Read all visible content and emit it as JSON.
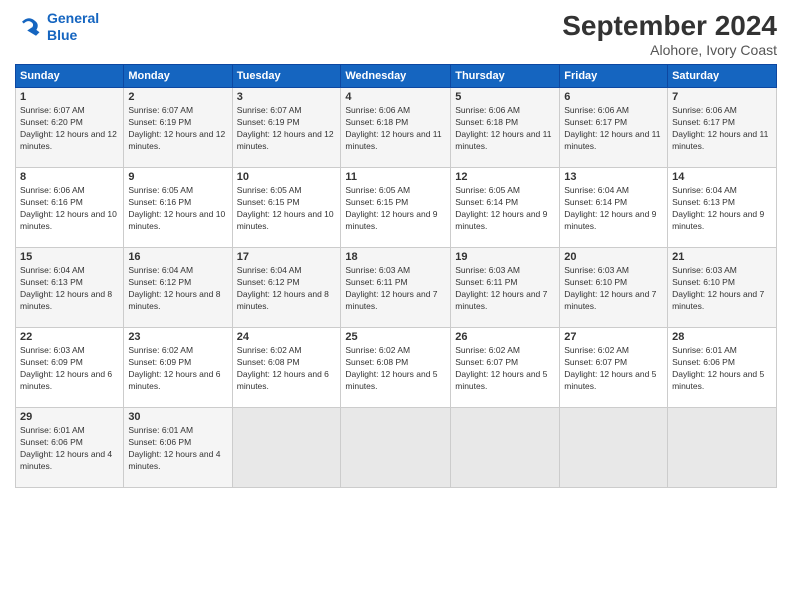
{
  "header": {
    "logo_line1": "General",
    "logo_line2": "Blue",
    "month": "September 2024",
    "location": "Alohore, Ivory Coast"
  },
  "weekdays": [
    "Sunday",
    "Monday",
    "Tuesday",
    "Wednesday",
    "Thursday",
    "Friday",
    "Saturday"
  ],
  "weeks": [
    [
      {
        "day": "1",
        "sunrise": "6:07 AM",
        "sunset": "6:20 PM",
        "daylight": "12 hours and 12 minutes."
      },
      {
        "day": "2",
        "sunrise": "6:07 AM",
        "sunset": "6:19 PM",
        "daylight": "12 hours and 12 minutes."
      },
      {
        "day": "3",
        "sunrise": "6:07 AM",
        "sunset": "6:19 PM",
        "daylight": "12 hours and 12 minutes."
      },
      {
        "day": "4",
        "sunrise": "6:06 AM",
        "sunset": "6:18 PM",
        "daylight": "12 hours and 11 minutes."
      },
      {
        "day": "5",
        "sunrise": "6:06 AM",
        "sunset": "6:18 PM",
        "daylight": "12 hours and 11 minutes."
      },
      {
        "day": "6",
        "sunrise": "6:06 AM",
        "sunset": "6:17 PM",
        "daylight": "12 hours and 11 minutes."
      },
      {
        "day": "7",
        "sunrise": "6:06 AM",
        "sunset": "6:17 PM",
        "daylight": "12 hours and 11 minutes."
      }
    ],
    [
      {
        "day": "8",
        "sunrise": "6:06 AM",
        "sunset": "6:16 PM",
        "daylight": "12 hours and 10 minutes."
      },
      {
        "day": "9",
        "sunrise": "6:05 AM",
        "sunset": "6:16 PM",
        "daylight": "12 hours and 10 minutes."
      },
      {
        "day": "10",
        "sunrise": "6:05 AM",
        "sunset": "6:15 PM",
        "daylight": "12 hours and 10 minutes."
      },
      {
        "day": "11",
        "sunrise": "6:05 AM",
        "sunset": "6:15 PM",
        "daylight": "12 hours and 9 minutes."
      },
      {
        "day": "12",
        "sunrise": "6:05 AM",
        "sunset": "6:14 PM",
        "daylight": "12 hours and 9 minutes."
      },
      {
        "day": "13",
        "sunrise": "6:04 AM",
        "sunset": "6:14 PM",
        "daylight": "12 hours and 9 minutes."
      },
      {
        "day": "14",
        "sunrise": "6:04 AM",
        "sunset": "6:13 PM",
        "daylight": "12 hours and 9 minutes."
      }
    ],
    [
      {
        "day": "15",
        "sunrise": "6:04 AM",
        "sunset": "6:13 PM",
        "daylight": "12 hours and 8 minutes."
      },
      {
        "day": "16",
        "sunrise": "6:04 AM",
        "sunset": "6:12 PM",
        "daylight": "12 hours and 8 minutes."
      },
      {
        "day": "17",
        "sunrise": "6:04 AM",
        "sunset": "6:12 PM",
        "daylight": "12 hours and 8 minutes."
      },
      {
        "day": "18",
        "sunrise": "6:03 AM",
        "sunset": "6:11 PM",
        "daylight": "12 hours and 7 minutes."
      },
      {
        "day": "19",
        "sunrise": "6:03 AM",
        "sunset": "6:11 PM",
        "daylight": "12 hours and 7 minutes."
      },
      {
        "day": "20",
        "sunrise": "6:03 AM",
        "sunset": "6:10 PM",
        "daylight": "12 hours and 7 minutes."
      },
      {
        "day": "21",
        "sunrise": "6:03 AM",
        "sunset": "6:10 PM",
        "daylight": "12 hours and 7 minutes."
      }
    ],
    [
      {
        "day": "22",
        "sunrise": "6:03 AM",
        "sunset": "6:09 PM",
        "daylight": "12 hours and 6 minutes."
      },
      {
        "day": "23",
        "sunrise": "6:02 AM",
        "sunset": "6:09 PM",
        "daylight": "12 hours and 6 minutes."
      },
      {
        "day": "24",
        "sunrise": "6:02 AM",
        "sunset": "6:08 PM",
        "daylight": "12 hours and 6 minutes."
      },
      {
        "day": "25",
        "sunrise": "6:02 AM",
        "sunset": "6:08 PM",
        "daylight": "12 hours and 5 minutes."
      },
      {
        "day": "26",
        "sunrise": "6:02 AM",
        "sunset": "6:07 PM",
        "daylight": "12 hours and 5 minutes."
      },
      {
        "day": "27",
        "sunrise": "6:02 AM",
        "sunset": "6:07 PM",
        "daylight": "12 hours and 5 minutes."
      },
      {
        "day": "28",
        "sunrise": "6:01 AM",
        "sunset": "6:06 PM",
        "daylight": "12 hours and 5 minutes."
      }
    ],
    [
      {
        "day": "29",
        "sunrise": "6:01 AM",
        "sunset": "6:06 PM",
        "daylight": "12 hours and 4 minutes."
      },
      {
        "day": "30",
        "sunrise": "6:01 AM",
        "sunset": "6:06 PM",
        "daylight": "12 hours and 4 minutes."
      },
      null,
      null,
      null,
      null,
      null
    ]
  ]
}
